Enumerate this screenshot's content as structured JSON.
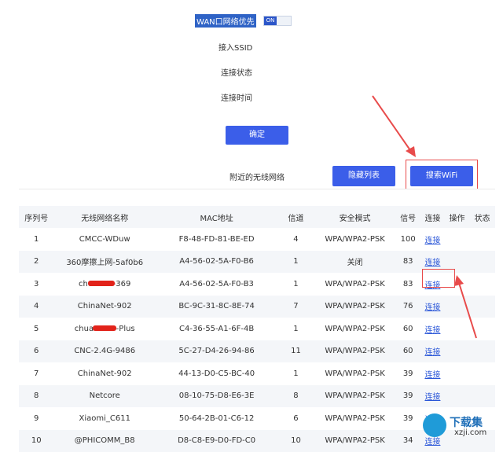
{
  "form": {
    "wan_priority_label": "WAN口网络优先",
    "toggle_state": "ON",
    "ssid_label": "接入SSID",
    "status_label": "连接状态",
    "time_label": "连接时间",
    "confirm_button": "确定"
  },
  "nearby": {
    "title": "附近的无线网络",
    "hidden_list_button": "隐藏列表",
    "search_wifi_button": "搜索WiFi"
  },
  "table": {
    "headers": [
      "序列号",
      "无线网络名称",
      "MAC地址",
      "信道",
      "安全模式",
      "信号",
      "连接",
      "操作",
      "状态"
    ],
    "rows": [
      {
        "idx": "1",
        "ssid": "CMCC-WDuw",
        "mac": "F8-48-FD-81-BE-ED",
        "channel": "4",
        "security": "WPA/WPA2-PSK",
        "signal": "100",
        "connect": "连接"
      },
      {
        "idx": "2",
        "ssid": "360摩擦上网-5af0b6",
        "mac": "A4-56-02-5A-F0-B6",
        "channel": "1",
        "security": "关闭",
        "signal": "83",
        "connect": "连接"
      },
      {
        "idx": "3",
        "ssid": "chu        -369",
        "mac": "A4-56-02-5A-F0-B3",
        "channel": "1",
        "security": "WPA/WPA2-PSK",
        "signal": "83",
        "connect": "连接"
      },
      {
        "idx": "4",
        "ssid": "ChinaNet-902",
        "mac": "BC-9C-31-8C-8E-74",
        "channel": "7",
        "security": "WPA/WPA2-PSK",
        "signal": "76",
        "connect": "连接"
      },
      {
        "idx": "5",
        "ssid": "chua         -Plus",
        "mac": "C4-36-55-A1-6F-4B",
        "channel": "1",
        "security": "WPA/WPA2-PSK",
        "signal": "60",
        "connect": "连接"
      },
      {
        "idx": "6",
        "ssid": "CNC-2.4G-9486",
        "mac": "5C-27-D4-26-94-86",
        "channel": "11",
        "security": "WPA/WPA2-PSK",
        "signal": "60",
        "connect": "连接"
      },
      {
        "idx": "7",
        "ssid": "ChinaNet-902",
        "mac": "44-13-D0-C5-BC-40",
        "channel": "1",
        "security": "WPA/WPA2-PSK",
        "signal": "39",
        "connect": "连接"
      },
      {
        "idx": "8",
        "ssid": "Netcore",
        "mac": "08-10-75-D8-E6-3E",
        "channel": "8",
        "security": "WPA/WPA2-PSK",
        "signal": "39",
        "connect": "连接"
      },
      {
        "idx": "9",
        "ssid": "Xiaomi_C611",
        "mac": "50-64-2B-01-C6-12",
        "channel": "6",
        "security": "WPA/WPA2-PSK",
        "signal": "39",
        "connect": "连接"
      },
      {
        "idx": "10",
        "ssid": "@PHICOMM_B8",
        "mac": "D8-C8-E9-D0-FD-C0",
        "channel": "10",
        "security": "WPA/WPA2-PSK",
        "signal": "34",
        "connect": "连接"
      }
    ]
  },
  "watermark": {
    "brand": "下载集",
    "url": "xzji.com"
  },
  "colors": {
    "accent": "#3b5ee9",
    "link": "#2b57d8",
    "annotation": "#e84b4b"
  }
}
